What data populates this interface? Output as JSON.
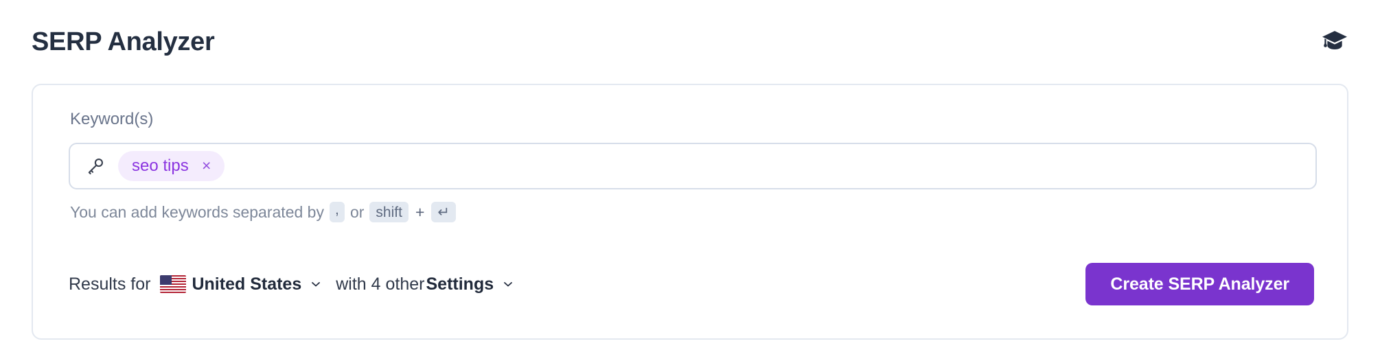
{
  "header": {
    "title": "SERP Analyzer",
    "icon": "graduation-cap-icon"
  },
  "card": {
    "keyword_field": {
      "label": "Keyword(s)",
      "icon": "key-icon",
      "tags": [
        {
          "label": "seo tips",
          "remove": "×"
        }
      ],
      "placeholder": ""
    },
    "hint": {
      "prefix": "You can add keywords separated by",
      "key_comma": ",",
      "conjunction": "or",
      "key_shift": "shift",
      "plus": "+",
      "key_enter": "↵"
    },
    "settings_row": {
      "results_for": "Results for",
      "country": {
        "flag": "us-flag-icon",
        "name": "United States",
        "chevron": "chevron-down-icon"
      },
      "with_other": "with 4 other",
      "settings": {
        "name": "Settings",
        "chevron": "chevron-down-icon"
      },
      "cta": "Create SERP Analyzer"
    }
  },
  "colors": {
    "accent_purple": "#7a34ce",
    "tag_bg": "#f4ecfd",
    "tag_text": "#8b35e0",
    "card_border": "#e3e8f0",
    "input_border": "#d6dde9",
    "title": "#242f41",
    "label": "#69748b",
    "kbd_bg": "#e3e9f1"
  }
}
